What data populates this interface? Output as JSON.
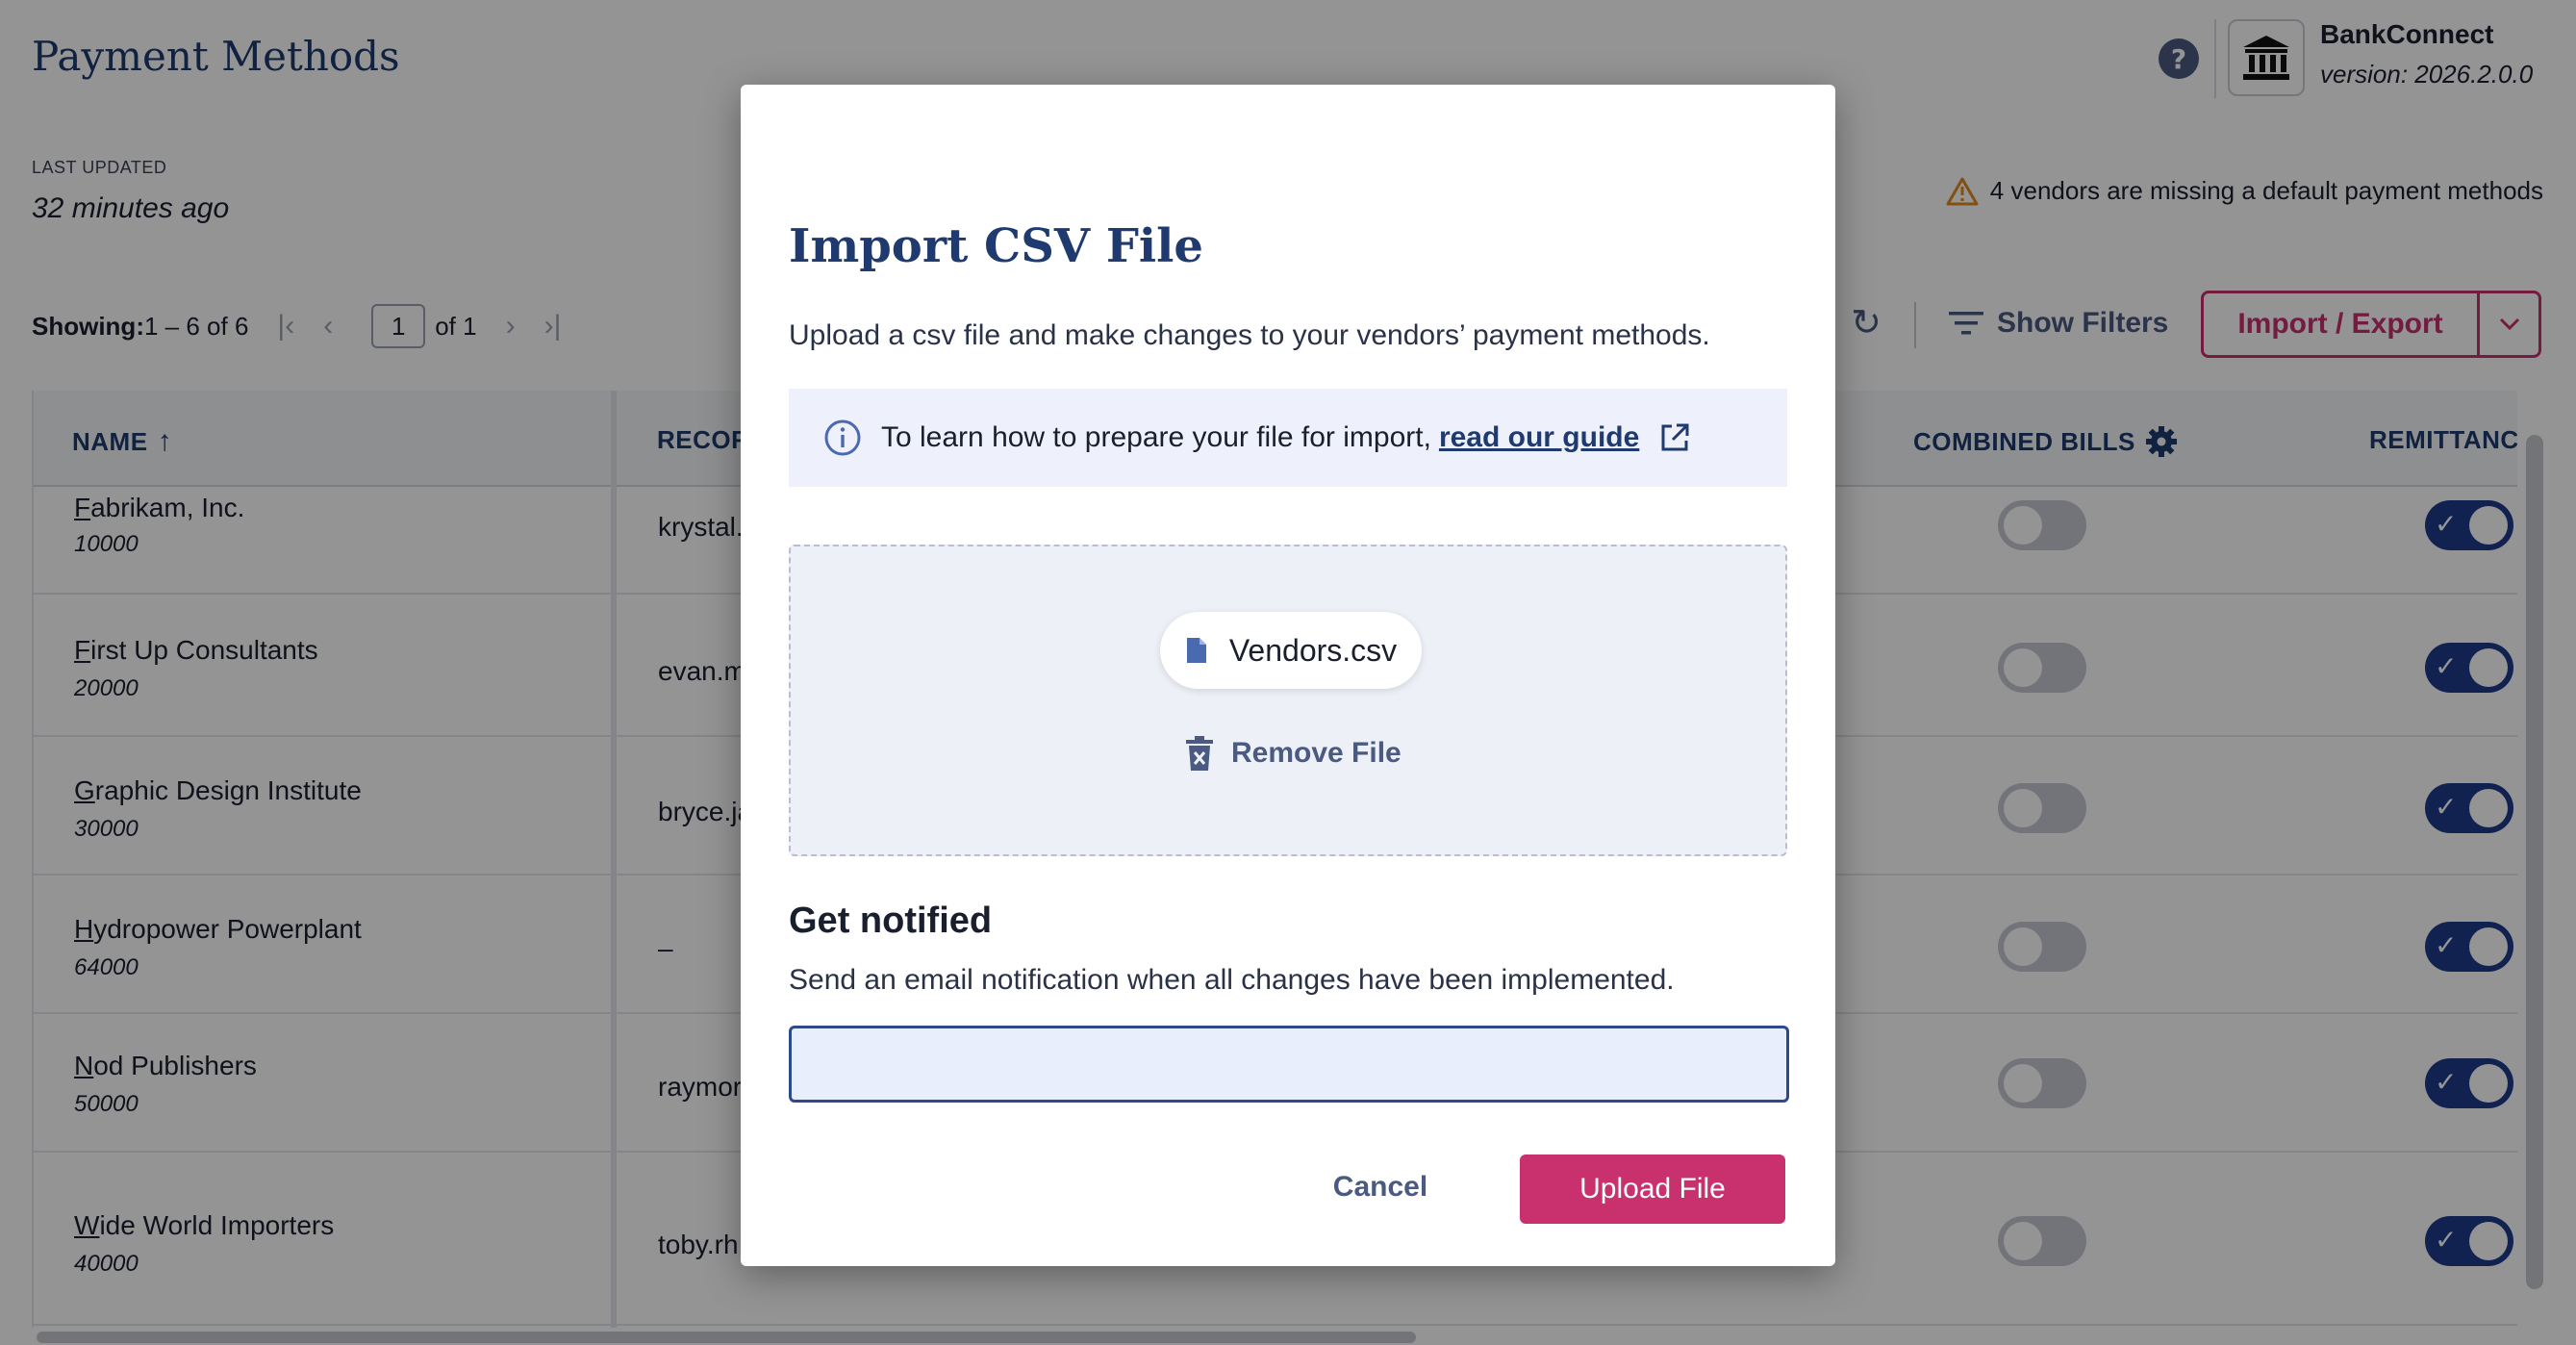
{
  "header": {
    "title": "Payment Methods",
    "help_glyph": "?",
    "app_name": "BankConnect",
    "version": "version: 2026.2.0.0",
    "last_updated_label": "LAST UPDATED",
    "last_updated_value": "32 minutes ago",
    "warning_text": "4 vendors are missing a default payment methods"
  },
  "pagination": {
    "showing_label": "Showing:",
    "showing_range": " 1 – 6 of 6",
    "current_page": "1",
    "of_pages": "of 1"
  },
  "toolbar": {
    "show_filters_label": "Show Filters",
    "import_export_label": "Import / Export"
  },
  "table": {
    "columns": {
      "name": "NAME",
      "record": "RECOR",
      "combined_bills": "COMBINED BILLS",
      "remittance": "REMITTANCI"
    },
    "rows": [
      {
        "name": "Fabrikam, Inc.",
        "id": "10000",
        "email": "krystal.",
        "combined_bills": false,
        "remittance": true
      },
      {
        "name": "First Up Consultants",
        "id": "20000",
        "email": "evan.m",
        "combined_bills": false,
        "remittance": true
      },
      {
        "name": "Graphic Design Institute",
        "id": "30000",
        "email": "bryce.ja",
        "combined_bills": false,
        "remittance": true
      },
      {
        "name": "Hydropower Powerplant",
        "id": "64000",
        "email": "–",
        "combined_bills": false,
        "remittance": true
      },
      {
        "name": "Nod Publishers",
        "id": "50000",
        "email": "raymor",
        "combined_bills": false,
        "remittance": true
      },
      {
        "name": "Wide World Importers",
        "id": "40000",
        "email": "toby.rh",
        "combined_bills": false,
        "remittance": true
      }
    ]
  },
  "modal": {
    "title": "Import CSV File",
    "description": "Upload a csv file and make changes to your vendors’ payment methods.",
    "info_text": "To learn how to prepare your file for import,",
    "guide_link": "read our guide",
    "file_name": "Vendors.csv",
    "remove_file_label": "Remove File",
    "notify_title": "Get notified",
    "notify_desc": "Send an email notification when all changes have been implemented.",
    "email_value": "",
    "email_placeholder": "",
    "cancel_label": "Cancel",
    "upload_label": "Upload File"
  },
  "colors": {
    "brand_navy": "#1e3a6e",
    "accent_pink": "#c8306e",
    "toggle_on": "#1e3a8a",
    "warning": "#e08a1e"
  },
  "icons": [
    "help-icon",
    "bank-icon",
    "warning-icon",
    "first-page-icon",
    "prev-page-icon",
    "next-page-icon",
    "last-page-icon",
    "refresh-icon",
    "filter-icon",
    "chevron-down-icon",
    "sort-asc-icon",
    "gear-icon",
    "info-icon",
    "external-link-icon",
    "file-icon",
    "trash-icon",
    "check-icon"
  ]
}
